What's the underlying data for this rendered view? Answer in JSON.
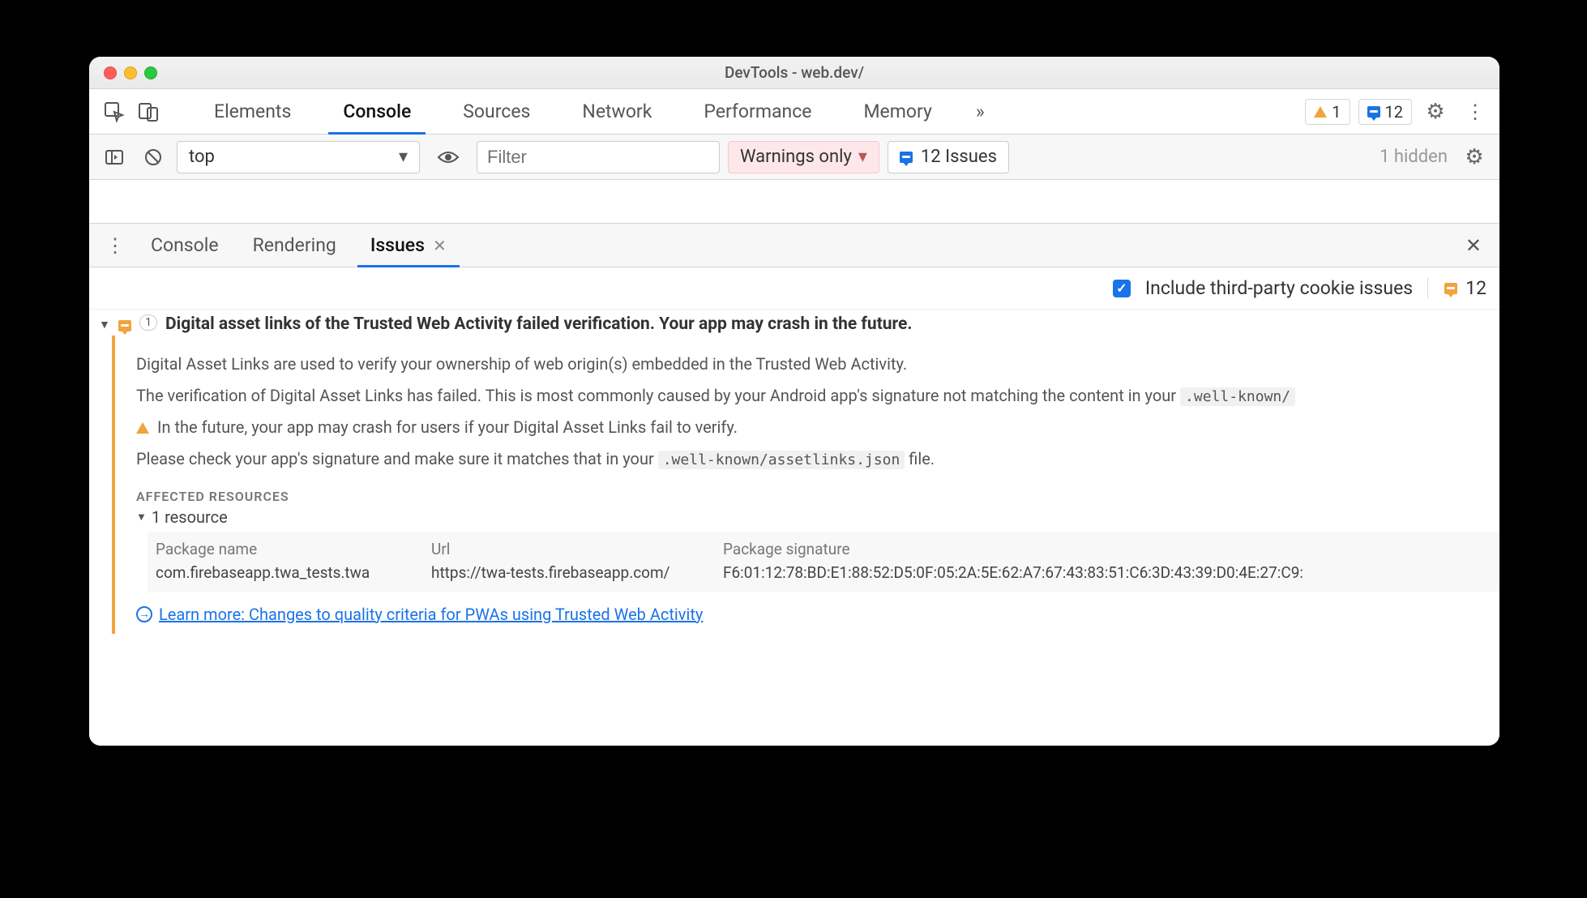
{
  "window": {
    "title": "DevTools - web.dev/"
  },
  "main_tabs": {
    "items": [
      "Elements",
      "Console",
      "Sources",
      "Network",
      "Performance",
      "Memory"
    ],
    "active_index": 1,
    "overflow": "»"
  },
  "toolbar_badges": {
    "warnings": {
      "count": "1"
    },
    "messages": {
      "count": "12"
    }
  },
  "console_bar": {
    "context": "top",
    "filter_placeholder": "Filter",
    "level": "Warnings only",
    "issues_button": "12 Issues",
    "hidden_text": "1 hidden"
  },
  "drawer_tabs": {
    "items": [
      "Console",
      "Rendering",
      "Issues"
    ],
    "active_index": 2
  },
  "issues_options": {
    "include_third_party_label": "Include third-party cookie issues",
    "total_count": "12"
  },
  "issue": {
    "count_chip": "1",
    "title": "Digital asset links of the Trusted Web Activity failed verification. Your app may crash in the future.",
    "p1": "Digital Asset Links are used to verify your ownership of web origin(s) embedded in the Trusted Web Activity.",
    "p2_pre": "The verification of Digital Asset Links has failed. This is most commonly caused by your Android app's signature not matching the content in your ",
    "p2_code": ".well-known/",
    "p3": "In the future, your app may crash for users if your Digital Asset Links fail to verify.",
    "p4_pre": "Please check your app's signature and make sure it matches that in your ",
    "p4_code": ".well-known/assetlinks.json",
    "p4_post": " file.",
    "affected_label": "AFFECTED RESOURCES",
    "resource_summary": "1 resource",
    "table": {
      "headers": [
        "Package name",
        "Url",
        "Package signature"
      ],
      "row": {
        "package": "com.firebaseapp.twa_tests.twa",
        "url": "https://twa-tests.firebaseapp.com/",
        "sig": "F6:01:12:78:BD:E1:88:52:D5:0F:05:2A:5E:62:A7:67:43:83:51:C6:3D:43:39:D0:4E:27:C9:"
      }
    },
    "learn_more": "Learn more: Changes to quality criteria for PWAs using Trusted Web Activity"
  }
}
